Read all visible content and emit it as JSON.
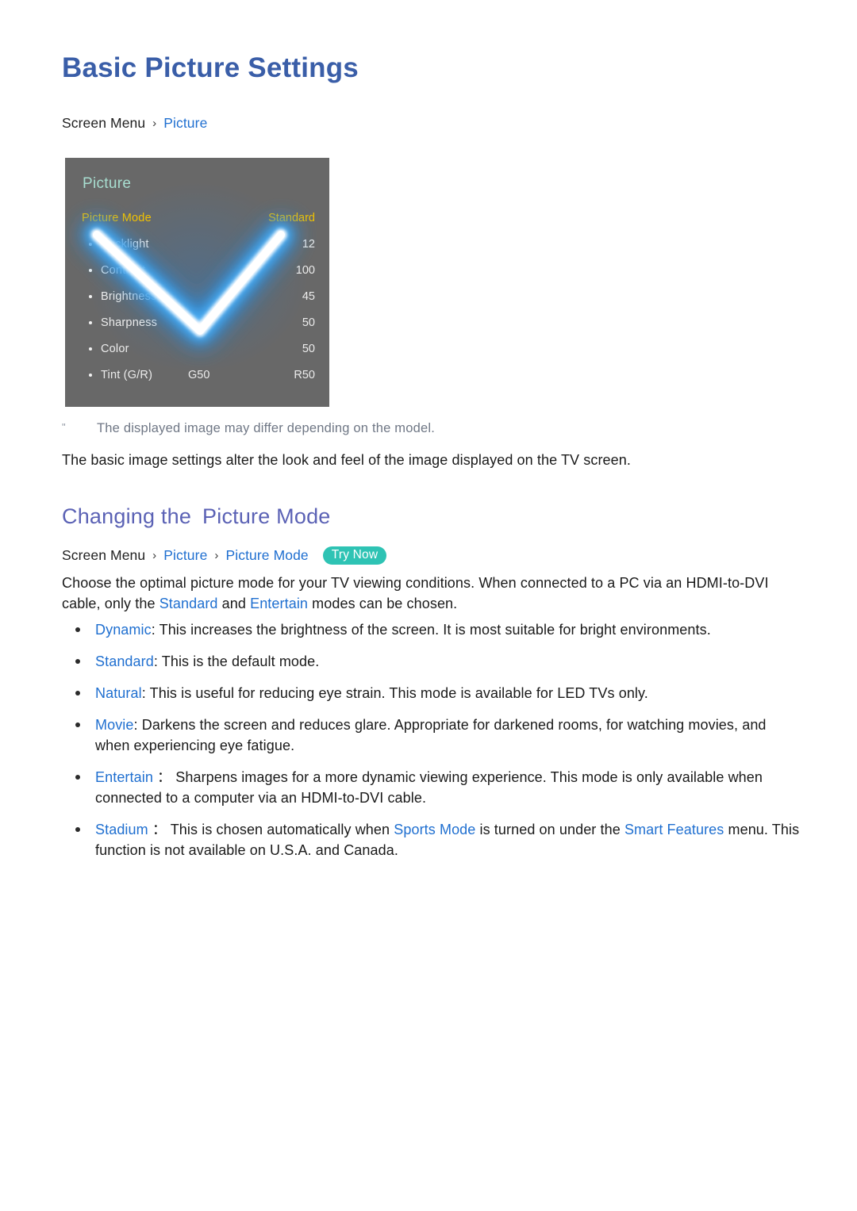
{
  "document": {
    "title": "Basic Picture Settings"
  },
  "breadcrumb_top": {
    "root": "Screen Menu",
    "separator": "›",
    "link1": "Picture"
  },
  "tv_menu": {
    "heading": "Picture",
    "header_row": {
      "label": "Picture Mode",
      "value": "Standard"
    },
    "rows": [
      {
        "label": "Backlight",
        "mid": "",
        "value": "12"
      },
      {
        "label": "Contrast",
        "mid": "",
        "value": "100"
      },
      {
        "label": "Brightness",
        "mid": "",
        "value": "45"
      },
      {
        "label": "Sharpness",
        "mid": "",
        "value": "50"
      },
      {
        "label": "Color",
        "mid": "",
        "value": "50"
      },
      {
        "label": "Tint (G/R)",
        "mid": "G50",
        "value": "R50"
      }
    ],
    "overlay_icon": "check-glow-icon"
  },
  "note": {
    "marker": "\"",
    "text": "The displayed image may differ depending on the model."
  },
  "intro_paragraph": "The basic image settings alter the look and feel of the image displayed on the TV screen.",
  "section": {
    "heading_part1": "Changing the",
    "heading_part2": "Picture Mode"
  },
  "breadcrumb_section": {
    "root": "Screen Menu",
    "separator": "›",
    "link1": "Picture",
    "link2": "Picture Mode",
    "badge": "Try Now"
  },
  "choose_paragraph": {
    "seg1": "Choose the optimal picture mode for your TV viewing conditions. When connected to a PC via an HDMI-to-DVI cable, only the ",
    "link1": "Standard",
    "seg2": " and ",
    "link2": "Entertain",
    "seg3": " modes can be chosen."
  },
  "modes": [
    {
      "name": "Dynamic",
      "colon": ":",
      "description": " This increases the brightness of the screen. It is most suitable for bright environments."
    },
    {
      "name": "Standard",
      "colon": ":",
      "description": " This is the default mode."
    },
    {
      "name": "Natural",
      "colon": ":",
      "description": " This is useful for reducing eye strain. This mode is available for LED TVs only."
    },
    {
      "name": "Movie",
      "colon": ":",
      "description": " Darkens the screen and reduces glare. Appropriate for darkened rooms, for watching movies, and when experiencing eye fatigue."
    },
    {
      "name": "Entertain",
      "colon": " ：",
      "description": " Sharpens images for a more dynamic viewing experience. This mode is only available when connected to a computer via an HDMI-to-DVI cable."
    }
  ],
  "stadium_mode": {
    "name": "Stadium",
    "colon": " ：",
    "seg1": " This is chosen automatically when ",
    "link1": "Sports Mode",
    "seg2": " is turned on under the ",
    "link2": "Smart Features",
    "seg3": " menu. This function is not available on U.S.A. and Canada."
  },
  "colors": {
    "page_title": "#3a5ea8",
    "section_heading": "#5b62b5",
    "link": "#1f6fd0",
    "badge_bg": "#2ec3b4",
    "note_text": "#6f7785",
    "tv_panel_bg": "#686868",
    "tv_heading": "#a8ded0",
    "tv_highlight": "#f2c200",
    "glow": "#2a8fe0"
  }
}
